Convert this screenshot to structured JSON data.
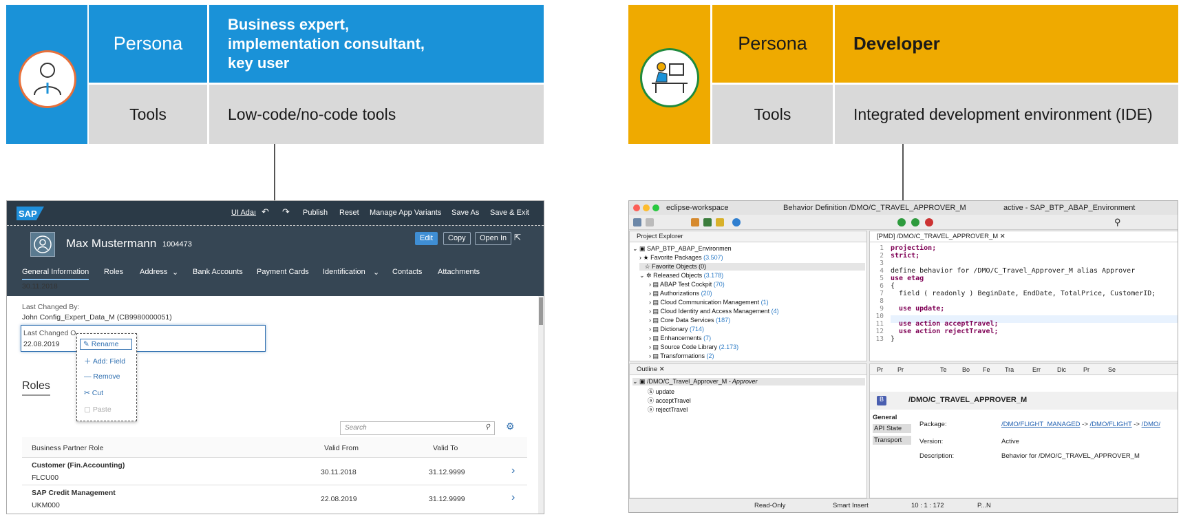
{
  "left_persona": {
    "persona_label": "Persona",
    "persona_value_lines": [
      "Business expert,",
      "implementation consultant,",
      "key user"
    ],
    "tools_label": "Tools",
    "tools_value": "Low-code/no-code tools",
    "color": "#1a92d8"
  },
  "right_persona": {
    "persona_label": "Persona",
    "persona_value": "Developer",
    "tools_label": "Tools",
    "tools_value": "Integrated development environment (IDE)",
    "color": "#efaa00"
  },
  "sap_app": {
    "logo": "SAP",
    "shell_buttons": [
      "UI Adaı",
      "Publish",
      "Reset",
      "Manage App Variants",
      "Save As",
      "Save & Exit"
    ],
    "user_name": "Max Mustermann",
    "user_id": "1004473",
    "header_buttons": [
      "Edit",
      "Copy",
      "Open In"
    ],
    "tabs": [
      "General Information",
      "Roles",
      "Address",
      "Bank Accounts",
      "Payment Cards",
      "Identification",
      "Contacts",
      "Attachments"
    ],
    "date_top": "30.11.2018",
    "last_changed_by_label": "Last Changed By:",
    "last_changed_by_value": "John Config_Expert_Data_M (CB9980000051)",
    "last_changed_on_label": "Last Changed O",
    "last_changed_on_value": "22.08.2019",
    "context_menu": [
      "Rename",
      "Add: Field",
      "Remove",
      "Cut",
      "Paste"
    ],
    "roles_title": "Roles",
    "search_placeholder": "Search",
    "table_headers": [
      "Business Partner Role",
      "Valid From",
      "Valid To"
    ],
    "rows": [
      {
        "role": "Customer (Fin.Accounting)",
        "code": "FLCU00",
        "from": "30.11.2018",
        "to": "31.12.9999"
      },
      {
        "role": "SAP Credit Management",
        "code": "UKM000",
        "from": "22.08.2019",
        "to": "31.12.9999"
      }
    ]
  },
  "eclipse": {
    "window_title_left": "eclipse-workspace",
    "window_title_mid": "Behavior Definition /DMO/C_TRAVEL_APPROVER_M",
    "window_title_right": "active - SAP_BTP_ABAP_Environment",
    "project_explorer_title": "Project Explorer",
    "project_root": "SAP_BTP_ABAP_Environmen",
    "tree": [
      {
        "label": "Favorite Packages",
        "count": "(3.507)"
      },
      {
        "label": "Favorite Objects (0)",
        "count": ""
      },
      {
        "label": "Released Objects",
        "count": "(3.178)"
      },
      {
        "label": "ABAP Test Cockpit",
        "count": "(70)"
      },
      {
        "label": "Authorizations",
        "count": "(20)"
      },
      {
        "label": "Cloud Communication Management",
        "count": "(1)"
      },
      {
        "label": "Cloud Identity and Access Management",
        "count": "(4)"
      },
      {
        "label": "Core Data Services",
        "count": "(187)"
      },
      {
        "label": "Dictionary",
        "count": "(714)"
      },
      {
        "label": "Enhancements",
        "count": "(7)"
      },
      {
        "label": "Source Code Library",
        "count": "(2.173)"
      },
      {
        "label": "Transformations",
        "count": "(2)"
      }
    ],
    "editor_tab": "[PMD] /DMO/C_TRAVEL_APPROVER_M",
    "code_lines": [
      "projection;",
      "strict;",
      "",
      "define behavior for /DMO/C_Travel_Approver_M alias Approver",
      "use etag",
      "{",
      "  field ( readonly ) BeginDate, EndDate, TotalPrice, CustomerID;",
      "",
      "  use update;",
      "",
      "  use action acceptTravel;",
      "  use action rejectTravel;",
      "}"
    ],
    "outline_title": "Outline",
    "outline_root": "/DMO/C_Travel_Approver_M",
    "outline_root_alias": "- Approver",
    "outline_items": [
      "update",
      "acceptTravel",
      "rejectTravel"
    ],
    "bottom_tabs": [
      "Pr",
      "Pr",
      "Te",
      "Bo",
      "Fe",
      "Tra",
      "Err",
      "Dic",
      "Pr",
      "Se"
    ],
    "props_title": "/DMO/C_TRAVEL_APPROVER_M",
    "props_sections": [
      "General",
      "API State",
      "Transport"
    ],
    "package_label": "Package:",
    "package_links": [
      "/DMO/FLIGHT_MANAGED",
      "/DMO/FLIGHT",
      "/DMO/"
    ],
    "version_label": "Version:",
    "version_value": "Active",
    "description_label": "Description:",
    "description_value": "Behavior for /DMO/C_TRAVEL_APPROVER_M",
    "status": [
      "Read-Only",
      "Smart Insert",
      "10 : 1 : 172",
      "P...N"
    ]
  }
}
